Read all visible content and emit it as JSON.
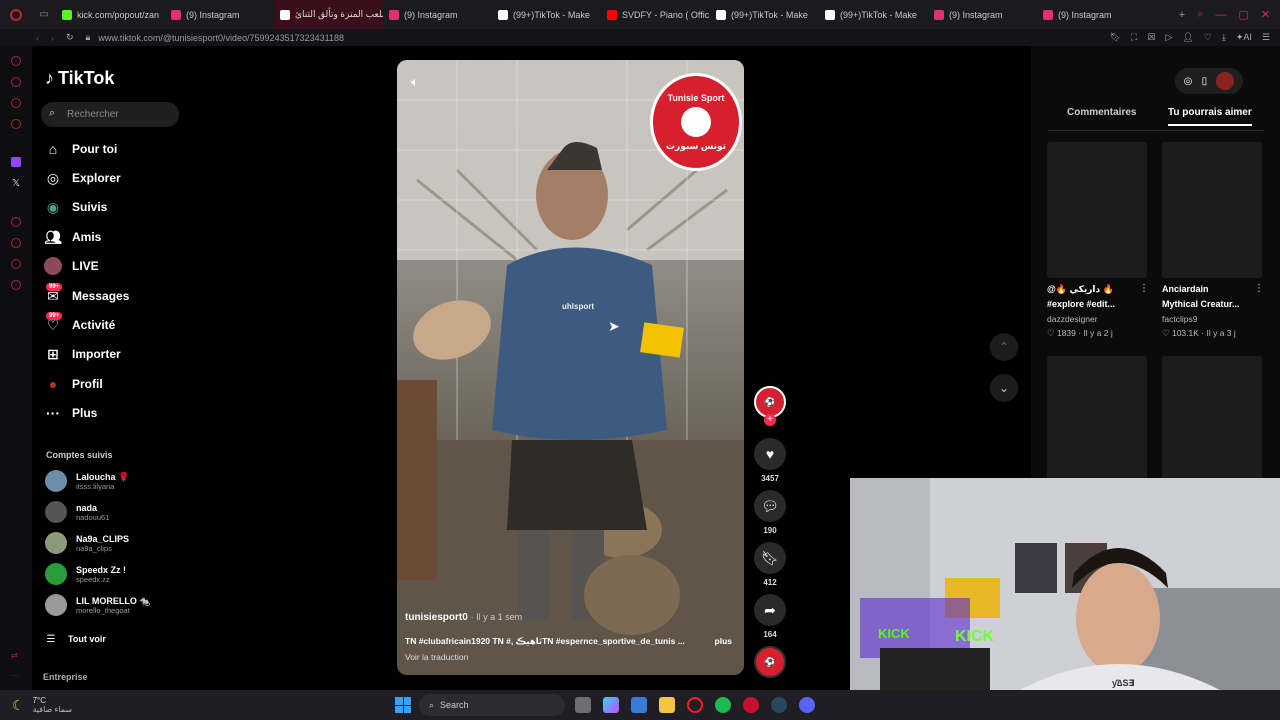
{
  "browser": {
    "tabs": [
      {
        "label": "kick.com/popout/zan",
        "color": "#53fc18"
      },
      {
        "label": "(9) Instagram",
        "color": "#e1306c"
      },
      {
        "label": "تاريخ ملعب المنزة وتألق الثنائ",
        "color": "#ffffff",
        "active": true
      },
      {
        "label": "(9) Instagram",
        "color": "#e1306c"
      },
      {
        "label": "(99+)TikTok - Make",
        "color": "#ffffff"
      },
      {
        "label": "SVDFY - Piano ( Offic",
        "color": "#ff0000"
      },
      {
        "label": "(99+)TikTok - Make",
        "color": "#ffffff"
      },
      {
        "label": "(99+)TikTok - Make",
        "color": "#ffffff"
      },
      {
        "label": "(9) Instagram",
        "color": "#e1306c"
      },
      {
        "label": "(9) Instagram",
        "color": "#e1306c"
      }
    ],
    "url": "www.tiktok.com/@tunisiesport0/video/7599243517323431188",
    "address_icons": [
      "bookmark-icon",
      "screenshot-icon",
      "close-square-icon",
      "play-icon",
      "person-icon",
      "heart-icon",
      "download-icon",
      "ai-icon",
      "menu-icon"
    ],
    "address_ai_label": "AI"
  },
  "tiktok": {
    "logo": "TikTok",
    "search_placeholder": "Rechercher",
    "nav": [
      {
        "label": "Pour toi",
        "icon": "home-icon"
      },
      {
        "label": "Explorer",
        "icon": "compass-icon"
      },
      {
        "label": "Suivis",
        "icon": "following-icon"
      },
      {
        "label": "Amis",
        "icon": "friends-icon"
      },
      {
        "label": "LIVE",
        "icon": "live-icon"
      },
      {
        "label": "Messages",
        "icon": "messages-icon",
        "badge": "99+"
      },
      {
        "label": "Activité",
        "icon": "activity-icon",
        "badge": "99+"
      },
      {
        "label": "Importer",
        "icon": "upload-icon"
      },
      {
        "label": "Profil",
        "icon": "profile-icon"
      },
      {
        "label": "Plus",
        "icon": "more-icon"
      }
    ],
    "followed_title": "Comptes suivis",
    "followed": [
      {
        "name": "Laloucha 🌹",
        "handle": "itsss.lilyana",
        "color": "#6b8fa8"
      },
      {
        "name": "nada",
        "handle": "nadouu61",
        "color": "#555"
      },
      {
        "name": "Na9a_CLIPS",
        "handle": "na9a_clips",
        "color": "#8a9a7a"
      },
      {
        "name": "Speedx Zz !",
        "handle": "speedx.zz",
        "color": "#2a9d3a"
      },
      {
        "name": "LIL MORELLO 🐀",
        "handle": "morello_thegoat",
        "color": "#999"
      }
    ],
    "see_all": "Tout voir",
    "footer": "Entreprise"
  },
  "video": {
    "author": "tunisiesport0",
    "time": "· Il y a 1 sem",
    "caption": "TN #clubafricain1920 TN #, ٿاهيڪTN #espernce_sportive_de_tunis ...",
    "more": "plus",
    "translate": "Voir la traduction",
    "channel_logo_text": "Tunisie Sport",
    "channel_logo_ar": "تونس سبورت",
    "shirt_brand": "uhlsport",
    "likes": "3457",
    "comments": "190",
    "saves": "412",
    "shares": "164"
  },
  "right_panel": {
    "tabs": [
      "Commentaires",
      "Tu pourrais aimer"
    ],
    "active_tab": "Tu pourrais aimer",
    "cards": [
      {
        "title": "@🔥 داريكي 🔥",
        "title2": "#explore #edit...",
        "author": "dazzdesigner",
        "stats": "♡ 1839 · Il y a 2 j"
      },
      {
        "title": "Anciardain",
        "title2": "Mythical Creatur...",
        "author": "factclips9",
        "stats": "♡ 103.1K · Il y a 3 j"
      }
    ]
  },
  "webcam": {
    "sign_left": "KICK",
    "sign_right": "KICK",
    "hoodie_text": "ƴ∆S∃"
  },
  "taskbar": {
    "weather_temp": "7°C",
    "weather_desc": "سماء صافية",
    "search_label": "Search"
  }
}
